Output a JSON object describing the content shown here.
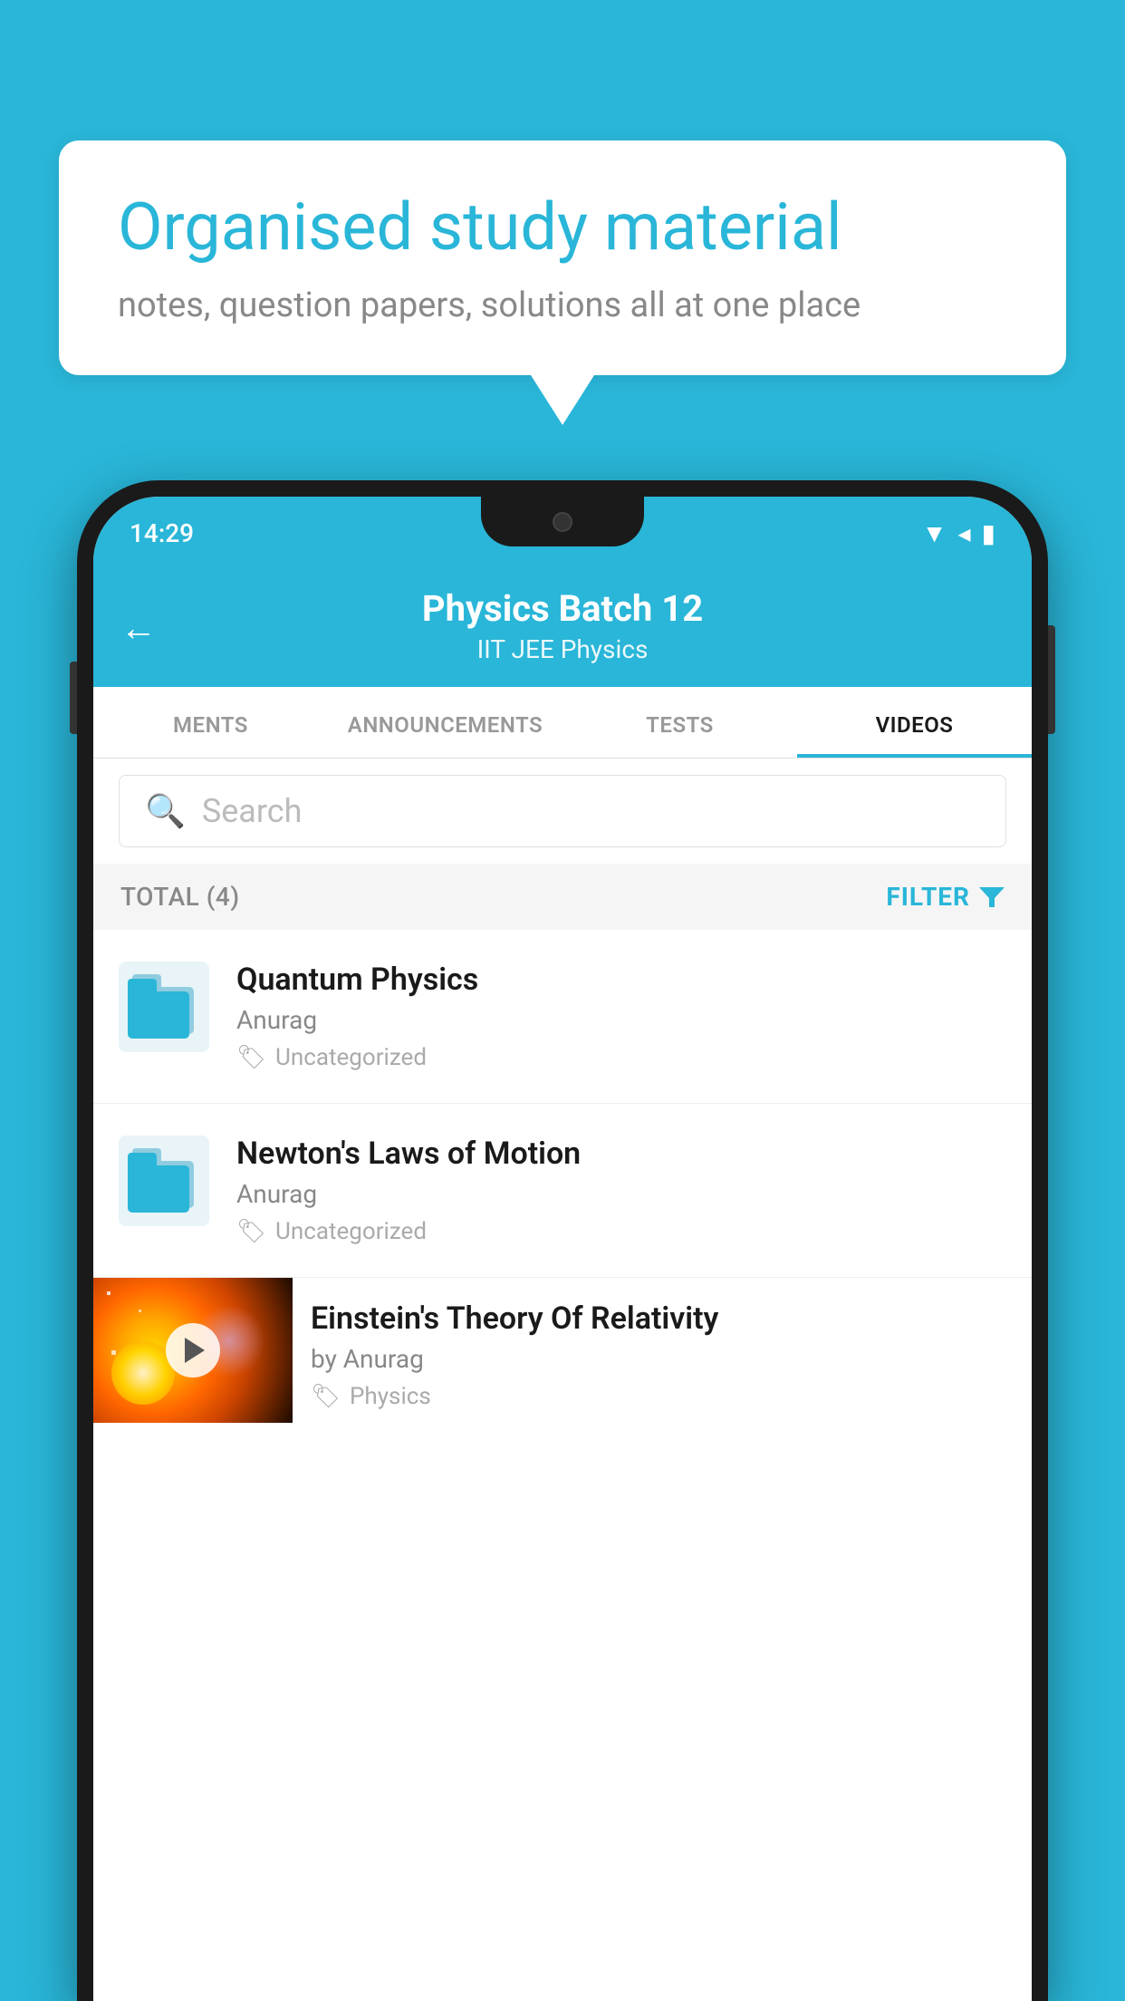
{
  "background_color": "#29b6d8",
  "speech_bubble": {
    "title": "Organised study material",
    "subtitle": "notes, question papers, solutions all at one place"
  },
  "phone": {
    "time": "14:29",
    "header": {
      "title": "Physics Batch 12",
      "subtitle": "IIT JEE   Physics"
    },
    "tabs": [
      {
        "label": "MENTS",
        "active": false
      },
      {
        "label": "ANNOUNCEMENTS",
        "active": false
      },
      {
        "label": "TESTS",
        "active": false
      },
      {
        "label": "VIDEOS",
        "active": true
      }
    ],
    "search": {
      "placeholder": "Search"
    },
    "filter_bar": {
      "total": "TOTAL (4)",
      "filter_label": "FILTER"
    },
    "videos": [
      {
        "title": "Quantum Physics",
        "author": "Anurag",
        "tag": "Uncategorized",
        "type": "folder"
      },
      {
        "title": "Newton's Laws of Motion",
        "author": "Anurag",
        "tag": "Uncategorized",
        "type": "folder"
      },
      {
        "title": "Einstein's Theory Of Relativity",
        "author": "by Anurag",
        "tag": "Physics",
        "type": "video"
      }
    ]
  }
}
